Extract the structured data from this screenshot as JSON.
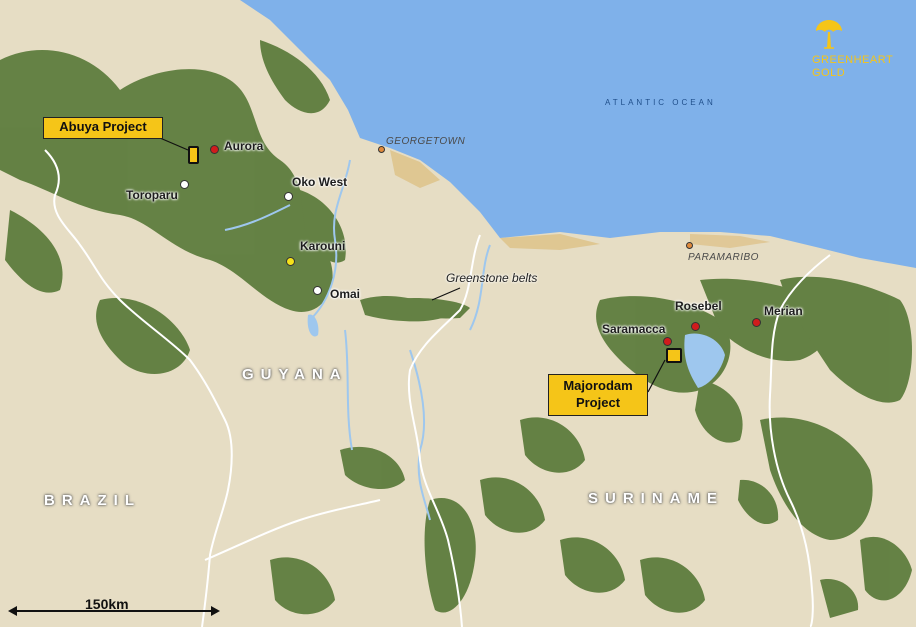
{
  "colors": {
    "ocean": "#7fb1ea",
    "land": "#e6ddc4",
    "greenstone": "#5a7a3a",
    "border": "#ffffff",
    "river": "#9ec7ee",
    "callout_fill": "#f5c518",
    "deposit_red": "#d01c1c",
    "deposit_white": "#ffffff",
    "deposit_yellow": "#f5e21a",
    "city_orange": "#e08a3c"
  },
  "logo": {
    "name": "GREENHEART GOLD",
    "line1": "GREENHEART",
    "line2": "GOLD",
    "icon": "tree-icon"
  },
  "ocean_label": "ATLANTIC OCEAN",
  "countries": {
    "guyana": "GUYANA",
    "suriname": "SURINAME",
    "brazil": "BRAZIL"
  },
  "cities": {
    "georgetown": "GEORGETOWN",
    "paramaribo": "PARAMARIBO"
  },
  "projects": {
    "abuya": {
      "label": "Abuya Project"
    },
    "majorodam": {
      "line1": "Majorodam",
      "line2": "Project"
    }
  },
  "deposits": {
    "aurora": {
      "label": "Aurora",
      "status": "red"
    },
    "toroparu": {
      "label": "Toroparu",
      "status": "white"
    },
    "oko_west": {
      "label": "Oko West",
      "status": "white"
    },
    "karouni": {
      "label": "Karouni",
      "status": "yellow"
    },
    "omai": {
      "label": "Omai",
      "status": "white"
    },
    "saramacca": {
      "label": "Saramacca",
      "status": "red"
    },
    "rosebel": {
      "label": "Rosebel",
      "status": "red"
    },
    "merian": {
      "label": "Merian",
      "status": "red"
    }
  },
  "greenstone_label": "Greenstone belts",
  "scale": {
    "label": "150km"
  }
}
